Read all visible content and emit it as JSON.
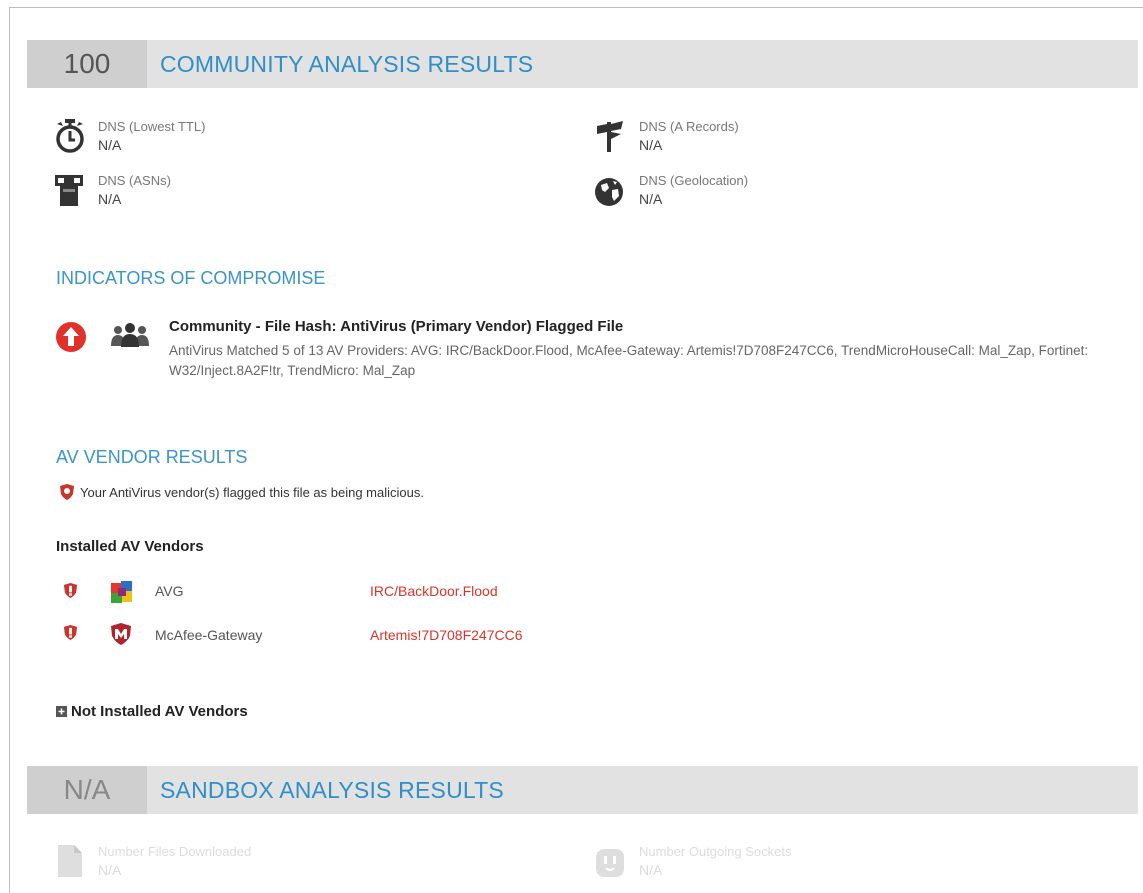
{
  "community": {
    "score": "100",
    "title": "COMMUNITY ANALYSIS RESULTS",
    "stats": [
      {
        "label": "DNS (Lowest TTL)",
        "value": "N/A",
        "icon": "stopwatch-icon"
      },
      {
        "label": "DNS (A Records)",
        "value": "N/A",
        "icon": "signpost-icon"
      },
      {
        "label": "DNS (ASNs)",
        "value": "N/A",
        "icon": "server-icon"
      },
      {
        "label": "DNS (Geolocation)",
        "value": "N/A",
        "icon": "globe-icon"
      }
    ]
  },
  "ioc": {
    "heading": "INDICATORS OF COMPROMISE",
    "title": "Community - File Hash: AntiVirus (Primary Vendor) Flagged File",
    "description": "AntiVirus Matched 5 of 13 AV Providers: AVG: IRC/BackDoor.Flood, McAfee-Gateway: Artemis!7D708F247CC6, TrendMicroHouseCall: Mal_Zap, Fortinet: W32/Inject.8A2F!tr, TrendMicro: Mal_Zap",
    "severity_color": "#e0322a"
  },
  "av": {
    "heading": "AV VENDOR RESULTS",
    "message": "Your AntiVirus vendor(s) flagged this file as being malicious.",
    "installed_heading": "Installed AV Vendors",
    "vendors": [
      {
        "name": "AVG",
        "result": "IRC/BackDoor.Flood"
      },
      {
        "name": "McAfee-Gateway",
        "result": "Artemis!7D708F247CC6"
      }
    ],
    "not_installed": "Not Installed AV Vendors"
  },
  "sandbox": {
    "score": "N/A",
    "title": "SANDBOX ANALYSIS RESULTS",
    "stats": [
      {
        "label": "Number Files Downloaded",
        "value": "N/A",
        "icon": "file-icon"
      },
      {
        "label": "Number Outgoing Sockets",
        "value": "N/A",
        "icon": "socket-icon"
      }
    ]
  },
  "colors": {
    "accent": "#2f8fc6",
    "danger": "#d9342b"
  }
}
